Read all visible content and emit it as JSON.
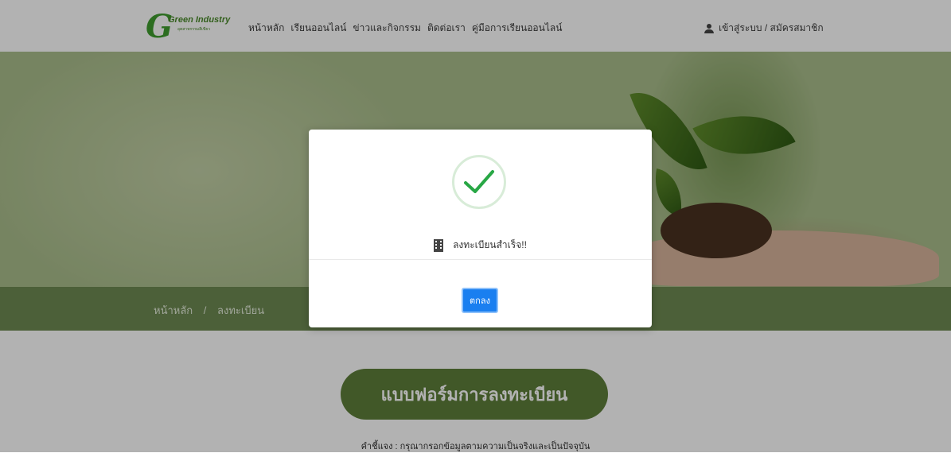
{
  "header": {
    "logo": {
      "title": "Green Industry",
      "subtitle": "อุตสาหกรรมสีเขียว"
    },
    "nav": [
      "หน้าหลัก",
      "เรียนออนไลน์",
      "ข่าวและกิจกรรม",
      "ติดต่อเรา",
      "คู่มือการเรียนออนไลน์"
    ],
    "login_label": "เข้าสู่ระบบ / สมัครสมาชิก"
  },
  "breadcrumb": {
    "home": "หน้าหลัก",
    "separator": "/",
    "current": "ลงทะเบียน"
  },
  "form": {
    "title": "แบบฟอร์มการลงทะเบียน",
    "note": "คำชี้แจง : กรุณากรอกข้อมูลตามความเป็นจริงและเป็นปัจจุบัน"
  },
  "modal": {
    "message": "ลงทะเบียนสำเร็จ!!",
    "ok_label": "ตกลง",
    "icon": "check-icon",
    "message_icon": "building-icon"
  },
  "colors": {
    "accent_green": "#5e7e3a",
    "primary_button": "#1a7ff0",
    "success_check": "#28a745"
  }
}
